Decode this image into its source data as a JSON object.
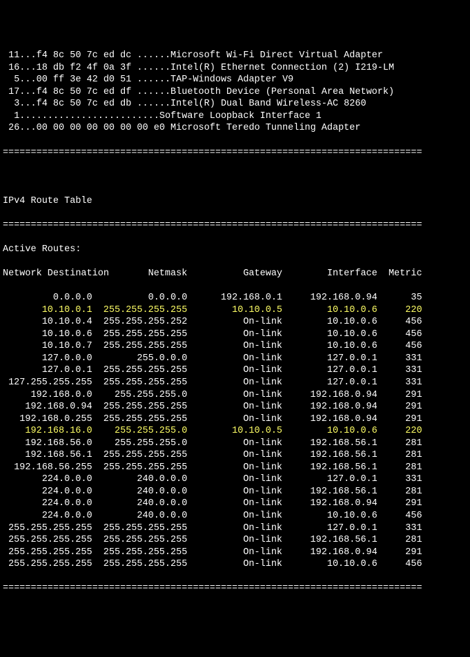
{
  "interfaces": [
    {
      "id": "11",
      "mac": "f4 8c 50 7c ed dc",
      "name": "Microsoft Wi-Fi Direct Virtual Adapter"
    },
    {
      "id": "16",
      "mac": "18 db f2 4f 0a 3f",
      "name": "Intel(R) Ethernet Connection (2) I219-LM"
    },
    {
      "id": "5",
      "mac": "00 ff 3e 42 d0 51",
      "name": "TAP-Windows Adapter V9"
    },
    {
      "id": "17",
      "mac": "f4 8c 50 7c ed df",
      "name": "Bluetooth Device (Personal Area Network)"
    },
    {
      "id": "3",
      "mac": "f4 8c 50 7c ed db",
      "name": "Intel(R) Dual Band Wireless-AC 8260"
    },
    {
      "id": "1",
      "mac": "",
      "name": "Software Loopback Interface 1"
    },
    {
      "id": "26",
      "mac": "00 00 00 00 00 00 00 e0",
      "name": "Microsoft Teredo Tunneling Adapter"
    }
  ],
  "route_table_title": "IPv4 Route Table",
  "active_routes_label": "Active Routes:",
  "headers": {
    "destination": "Network Destination",
    "netmask": "Netmask",
    "gateway": "Gateway",
    "interface": "Interface",
    "metric": "Metric"
  },
  "routes": [
    {
      "dest": "0.0.0.0",
      "mask": "0.0.0.0",
      "gw": "192.168.0.1",
      "iface": "192.168.0.94",
      "metric": "35",
      "hl": false
    },
    {
      "dest": "10.10.0.1",
      "mask": "255.255.255.255",
      "gw": "10.10.0.5",
      "iface": "10.10.0.6",
      "metric": "220",
      "hl": true
    },
    {
      "dest": "10.10.0.4",
      "mask": "255.255.255.252",
      "gw": "On-link",
      "iface": "10.10.0.6",
      "metric": "456",
      "hl": false
    },
    {
      "dest": "10.10.0.6",
      "mask": "255.255.255.255",
      "gw": "On-link",
      "iface": "10.10.0.6",
      "metric": "456",
      "hl": false
    },
    {
      "dest": "10.10.0.7",
      "mask": "255.255.255.255",
      "gw": "On-link",
      "iface": "10.10.0.6",
      "metric": "456",
      "hl": false
    },
    {
      "dest": "127.0.0.0",
      "mask": "255.0.0.0",
      "gw": "On-link",
      "iface": "127.0.0.1",
      "metric": "331",
      "hl": false
    },
    {
      "dest": "127.0.0.1",
      "mask": "255.255.255.255",
      "gw": "On-link",
      "iface": "127.0.0.1",
      "metric": "331",
      "hl": false
    },
    {
      "dest": "127.255.255.255",
      "mask": "255.255.255.255",
      "gw": "On-link",
      "iface": "127.0.0.1",
      "metric": "331",
      "hl": false
    },
    {
      "dest": "192.168.0.0",
      "mask": "255.255.255.0",
      "gw": "On-link",
      "iface": "192.168.0.94",
      "metric": "291",
      "hl": false
    },
    {
      "dest": "192.168.0.94",
      "mask": "255.255.255.255",
      "gw": "On-link",
      "iface": "192.168.0.94",
      "metric": "291",
      "hl": false
    },
    {
      "dest": "192.168.0.255",
      "mask": "255.255.255.255",
      "gw": "On-link",
      "iface": "192.168.0.94",
      "metric": "291",
      "hl": false
    },
    {
      "dest": "192.168.16.0",
      "mask": "255.255.255.0",
      "gw": "10.10.0.5",
      "iface": "10.10.0.6",
      "metric": "220",
      "hl": true
    },
    {
      "dest": "192.168.56.0",
      "mask": "255.255.255.0",
      "gw": "On-link",
      "iface": "192.168.56.1",
      "metric": "281",
      "hl": false
    },
    {
      "dest": "192.168.56.1",
      "mask": "255.255.255.255",
      "gw": "On-link",
      "iface": "192.168.56.1",
      "metric": "281",
      "hl": false
    },
    {
      "dest": "192.168.56.255",
      "mask": "255.255.255.255",
      "gw": "On-link",
      "iface": "192.168.56.1",
      "metric": "281",
      "hl": false
    },
    {
      "dest": "224.0.0.0",
      "mask": "240.0.0.0",
      "gw": "On-link",
      "iface": "127.0.0.1",
      "metric": "331",
      "hl": false
    },
    {
      "dest": "224.0.0.0",
      "mask": "240.0.0.0",
      "gw": "On-link",
      "iface": "192.168.56.1",
      "metric": "281",
      "hl": false
    },
    {
      "dest": "224.0.0.0",
      "mask": "240.0.0.0",
      "gw": "On-link",
      "iface": "192.168.0.94",
      "metric": "291",
      "hl": false
    },
    {
      "dest": "224.0.0.0",
      "mask": "240.0.0.0",
      "gw": "On-link",
      "iface": "10.10.0.6",
      "metric": "456",
      "hl": false
    },
    {
      "dest": "255.255.255.255",
      "mask": "255.255.255.255",
      "gw": "On-link",
      "iface": "127.0.0.1",
      "metric": "331",
      "hl": false
    },
    {
      "dest": "255.255.255.255",
      "mask": "255.255.255.255",
      "gw": "On-link",
      "iface": "192.168.56.1",
      "metric": "281",
      "hl": false
    },
    {
      "dest": "255.255.255.255",
      "mask": "255.255.255.255",
      "gw": "On-link",
      "iface": "192.168.0.94",
      "metric": "291",
      "hl": false
    },
    {
      "dest": "255.255.255.255",
      "mask": "255.255.255.255",
      "gw": "On-link",
      "iface": "10.10.0.6",
      "metric": "456",
      "hl": false
    }
  ],
  "divider": "==========================================================================="
}
